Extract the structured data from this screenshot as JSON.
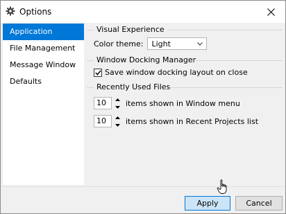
{
  "window": {
    "title": "Options",
    "icon": "gear-icon"
  },
  "sidebar": {
    "items": [
      {
        "label": "Application",
        "selected": true
      },
      {
        "label": "File Management",
        "selected": false
      },
      {
        "label": "Message Window",
        "selected": false
      },
      {
        "label": "Defaults",
        "selected": false
      }
    ]
  },
  "content": {
    "visual": {
      "header": "Visual Experience",
      "color_theme_label": "Color theme:",
      "color_theme_value": "Light"
    },
    "docking": {
      "header": "Window Docking Manager",
      "save_layout_label": "Save window docking layout on close",
      "save_layout_checked": true
    },
    "recent": {
      "header": "Recently Used Files",
      "window_menu_count": "10",
      "window_menu_label": "items shown in Window menu",
      "recent_projects_count": "10",
      "recent_projects_label": "items shown in Recent Projects list"
    }
  },
  "buttons": {
    "apply": "Apply",
    "cancel": "Cancel"
  },
  "colors": {
    "accent": "#0078d7",
    "apply_bg": "#cce4f7"
  }
}
